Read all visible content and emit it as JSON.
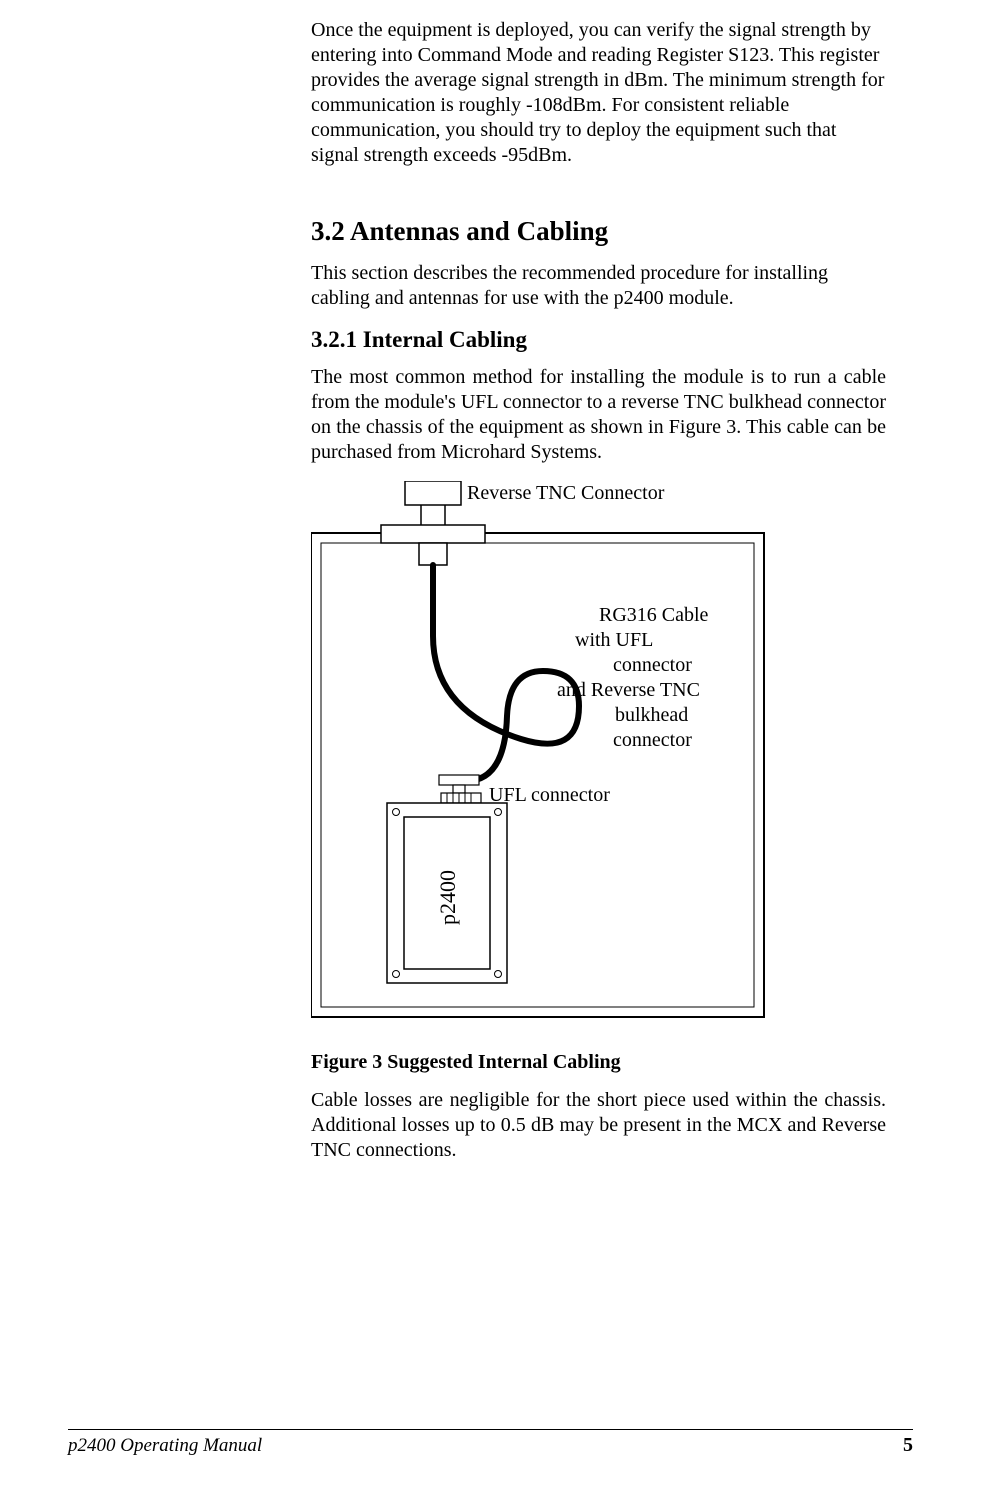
{
  "intro_para": "Once the equipment is deployed, you can verify the signal strength by entering into Command Mode and reading Register S123.  This register provides the average signal strength in dBm.  The minimum strength for communication is roughly -108dBm.  For consistent reliable communication, you should try to deploy the equipment such that signal strength exceeds -95dBm.",
  "section_3_2": {
    "heading": "3.2   Antennas and Cabling",
    "para": "This section describes the recommended procedure for installing cabling and antennas for use with the p2400 module."
  },
  "section_3_2_1": {
    "heading": "3.2.1    Internal Cabling",
    "para": "The most common method for installing the module is to run a cable from the module's UFL connector to a reverse TNC bulkhead connector on the chassis of the equipment as shown in Figure 3.  This cable can be purchased from Microhard Systems."
  },
  "figure": {
    "labels": {
      "reverse_tnc": "Reverse TNC Connector",
      "cable_l1": "RG316 Cable",
      "cable_l2": "with UFL",
      "cable_l3": "connector",
      "cable_l4": "and Reverse TNC",
      "cable_l5": "bulkhead",
      "cable_l6": "connector",
      "ufl": "UFL connector",
      "module": "p2400"
    },
    "caption": "Figure 3 Suggested Internal Cabling"
  },
  "para_losses": "Cable losses are negligible for the short piece used within the chassis.  Additional losses up to 0.5 dB may be present in the MCX and Reverse TNC connections.",
  "footer": {
    "left": "p2400 Operating Manual",
    "page": "5"
  }
}
